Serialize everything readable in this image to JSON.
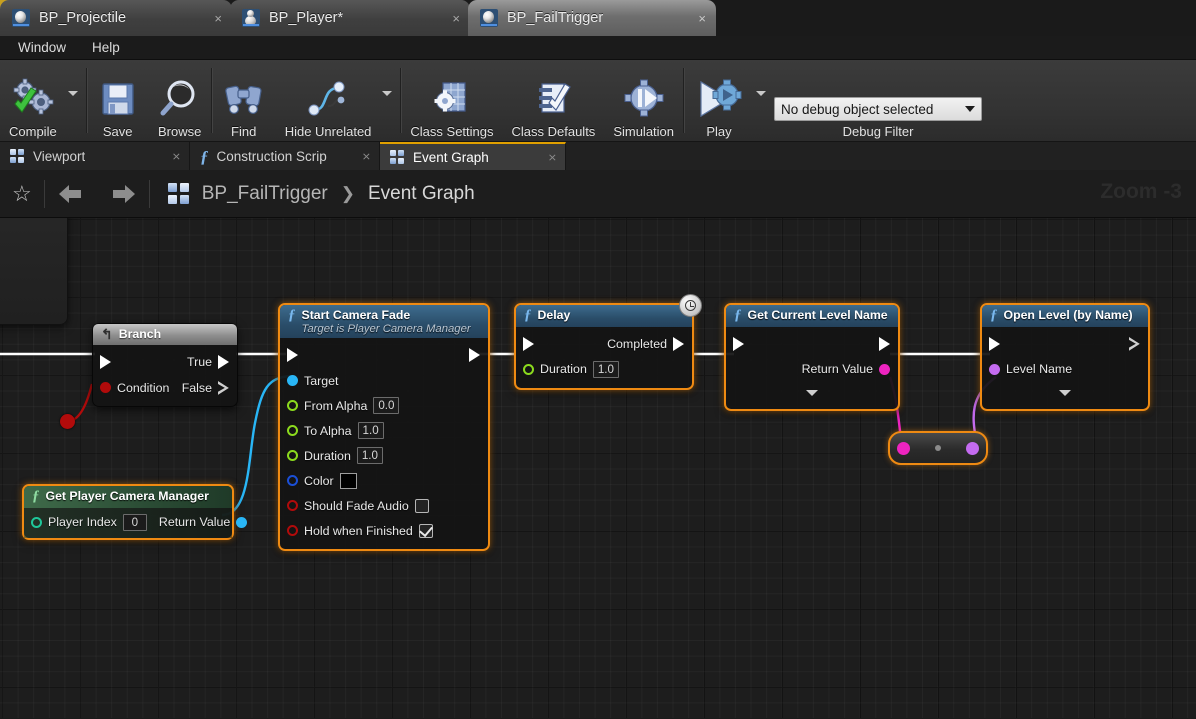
{
  "window": {
    "tabs": [
      {
        "label": "BP_Projectile",
        "icon": "blueprint-sphere-icon",
        "state": "inactive",
        "close": "×"
      },
      {
        "label": "BP_Player*",
        "icon": "blueprint-actor-icon",
        "state": "inactive",
        "close": "×"
      },
      {
        "label": "BP_FailTrigger",
        "icon": "blueprint-sphere-icon",
        "state": "active",
        "close": "×"
      }
    ],
    "menu": [
      "Window",
      "Help"
    ]
  },
  "toolbar": {
    "compile": "Compile",
    "save": "Save",
    "browse": "Browse",
    "find": "Find",
    "hide_unrelated": "Hide Unrelated",
    "class_settings": "Class Settings",
    "class_defaults": "Class Defaults",
    "simulation": "Simulation",
    "play": "Play",
    "debug_object": "No debug object selected",
    "debug_filter": "Debug Filter"
  },
  "doc_tabs": [
    {
      "label": "Viewport",
      "icon": "viewport-icon",
      "state": "inactive",
      "close": "⨯"
    },
    {
      "label": "Construction Scrip",
      "icon": "function-icon",
      "state": "inactive",
      "close": "⨯"
    },
    {
      "label": "Event Graph",
      "icon": "event-graph-icon",
      "state": "active",
      "close": "⨯"
    }
  ],
  "breadcrumb": {
    "blueprint": "BP_FailTrigger",
    "separator": "❯",
    "graph": "Event Graph",
    "zoom": "Zoom -3"
  },
  "graph": {
    "accent_selected": "#ef8a12",
    "nodes": [
      {
        "id": "branch",
        "title": "Branch",
        "header_style": "grey",
        "selected": false,
        "rows": [
          {
            "type": "exec-in-out",
            "right_label": "True"
          },
          {
            "type": "bool-in",
            "label": "Condition",
            "right_label": "False"
          }
        ]
      },
      {
        "id": "start-camera-fade",
        "title": "Start Camera Fade",
        "subtitle": "Target is Player Camera Manager",
        "header_style": "fn",
        "selected": true,
        "rows": [
          {
            "type": "exec",
            "label": ""
          },
          {
            "type": "object",
            "label": "Target",
            "color": "#29b6f6"
          },
          {
            "type": "float",
            "label": "From Alpha",
            "value": "0.0",
            "color": "#8cdb1e"
          },
          {
            "type": "float",
            "label": "To Alpha",
            "value": "1.0",
            "color": "#8cdb1e"
          },
          {
            "type": "float",
            "label": "Duration",
            "value": "1.0",
            "color": "#8cdb1e"
          },
          {
            "type": "struct",
            "label": "Color",
            "value": "#000000",
            "color": "#1b4fd6"
          },
          {
            "type": "bool",
            "label": "Should Fade Audio",
            "checked": false,
            "color": "#b10b0b"
          },
          {
            "type": "bool",
            "label": "Hold when Finished",
            "checked": true,
            "color": "#b10b0b"
          }
        ]
      },
      {
        "id": "delay",
        "title": "Delay",
        "header_style": "fn",
        "selected": true,
        "badge": "latent-clock-icon",
        "rows": [
          {
            "type": "exec-in-out",
            "right_label": "Completed"
          },
          {
            "type": "float",
            "label": "Duration",
            "value": "1.0",
            "color": "#8cdb1e"
          }
        ]
      },
      {
        "id": "get-current-level-name",
        "title": "Get Current Level Name",
        "header_style": "fn",
        "selected": true,
        "rows": [
          {
            "type": "exec-in-out",
            "right_label": ""
          },
          {
            "type": "string-out",
            "right_label": "Return Value",
            "color": "#ee24c0"
          }
        ],
        "expander": true
      },
      {
        "id": "open-level-by-name",
        "title": "Open Level (by Name)",
        "header_style": "fn",
        "selected": true,
        "rows": [
          {
            "type": "exec-in-out-hollow",
            "right_label": ""
          },
          {
            "type": "name-in",
            "label": "Level Name",
            "color": "#c46bf0"
          }
        ],
        "expander": true
      },
      {
        "id": "get-player-camera-manager",
        "title": "Get Player Camera Manager",
        "header_style": "pure",
        "selected": true,
        "rows": [
          {
            "type": "int-in-obj-out",
            "label": "Player Index",
            "value": "0",
            "right_label": "Return Value",
            "color_in": "#1fc79a",
            "color_out": "#29b6f6"
          }
        ]
      }
    ],
    "knot": {
      "id": "reroute-knot",
      "selected": true,
      "in_color": "#ee24c0",
      "out_color": "#c46bf0"
    },
    "partial_node": {
      "id": "equality-node",
      "glyph": "==",
      "pin_color": "#b10b0b"
    },
    "wire_colors": {
      "exec": "#ffffff",
      "object": "#29b6f6",
      "bool": "#b10b0b",
      "string": "#ee24c0",
      "name": "#c46bf0"
    }
  }
}
